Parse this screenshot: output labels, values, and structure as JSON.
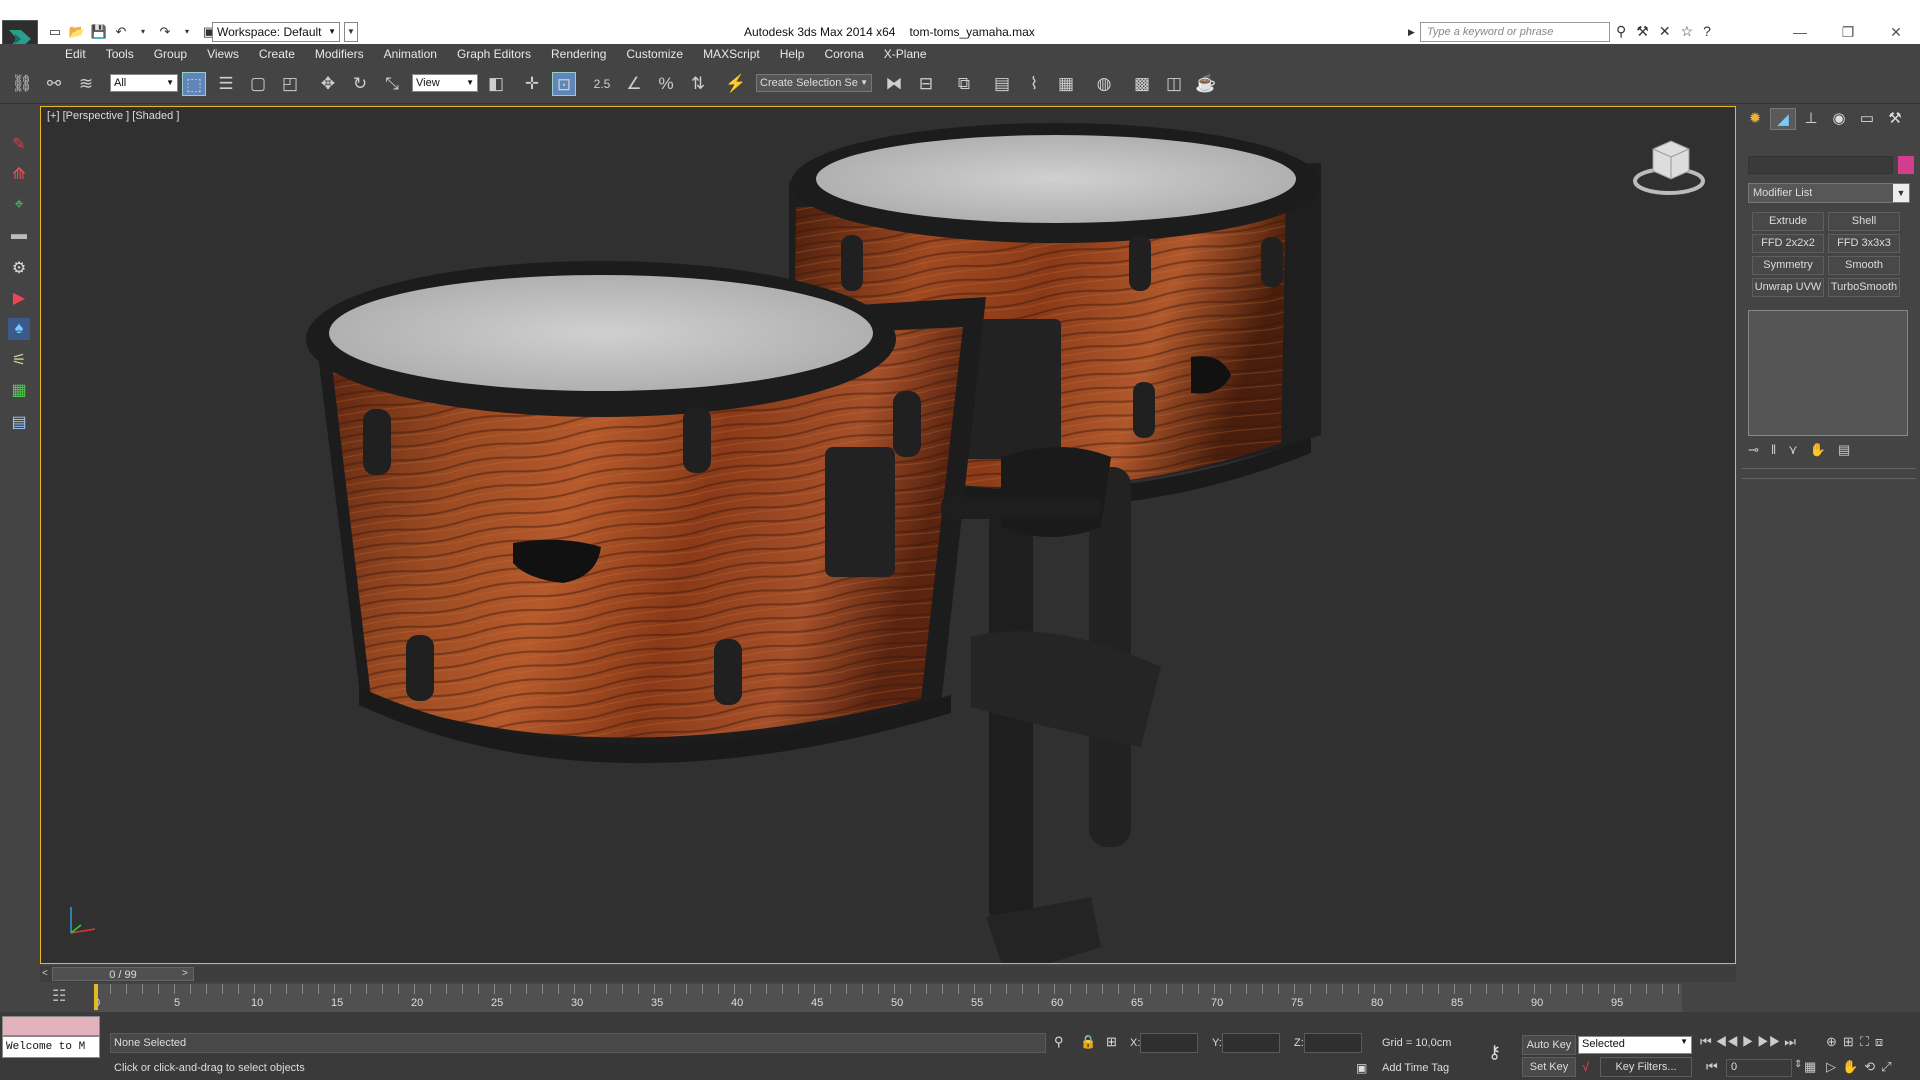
{
  "title": {
    "app": "Autodesk 3ds Max  2014 x64",
    "file": "tom-toms_yamaha.max",
    "workspace": "Workspace: Default",
    "search_placeholder": "Type a keyword or phrase"
  },
  "menu": [
    "Edit",
    "Tools",
    "Group",
    "Views",
    "Create",
    "Modifiers",
    "Animation",
    "Graph Editors",
    "Rendering",
    "Customize",
    "MAXScript",
    "Help",
    "Corona",
    "X-Plane"
  ],
  "toolbar": {
    "selection_filter": "All",
    "ref_coord": "View",
    "snap_label": "2.5",
    "named_selection_placeholder": "Create Selection Se"
  },
  "viewport": {
    "label": "[+] [Perspective ] [Shaded ]"
  },
  "command_panel": {
    "modifier_list": "Modifier List",
    "object_color": "#d23d8c",
    "modifier_buttons": [
      "Extrude",
      "Shell",
      "FFD 2x2x2",
      "FFD 3x3x3",
      "Symmetry",
      "Smooth",
      "Unwrap UVW",
      "TurboSmooth"
    ]
  },
  "timeline": {
    "frame_display": "0 / 99",
    "prev": "<",
    "next": ">",
    "ticks": [
      "0",
      "5",
      "10",
      "15",
      "20",
      "25",
      "30",
      "35",
      "40",
      "45",
      "50",
      "55",
      "60",
      "65",
      "70",
      "75",
      "80",
      "85",
      "90",
      "95"
    ]
  },
  "status": {
    "selection": "None Selected",
    "prompt": "Click or click-and-drag to select objects",
    "maxscript": "Welcome to M",
    "x_label": "X:",
    "y_label": "Y:",
    "z_label": "Z:",
    "grid": "Grid = 10,0cm",
    "add_time_tag": "Add Time Tag",
    "auto_key": "Auto Key",
    "set_key": "Set Key",
    "key_mode": "Selected",
    "key_filters": "Key Filters...",
    "current_frame": "0"
  }
}
